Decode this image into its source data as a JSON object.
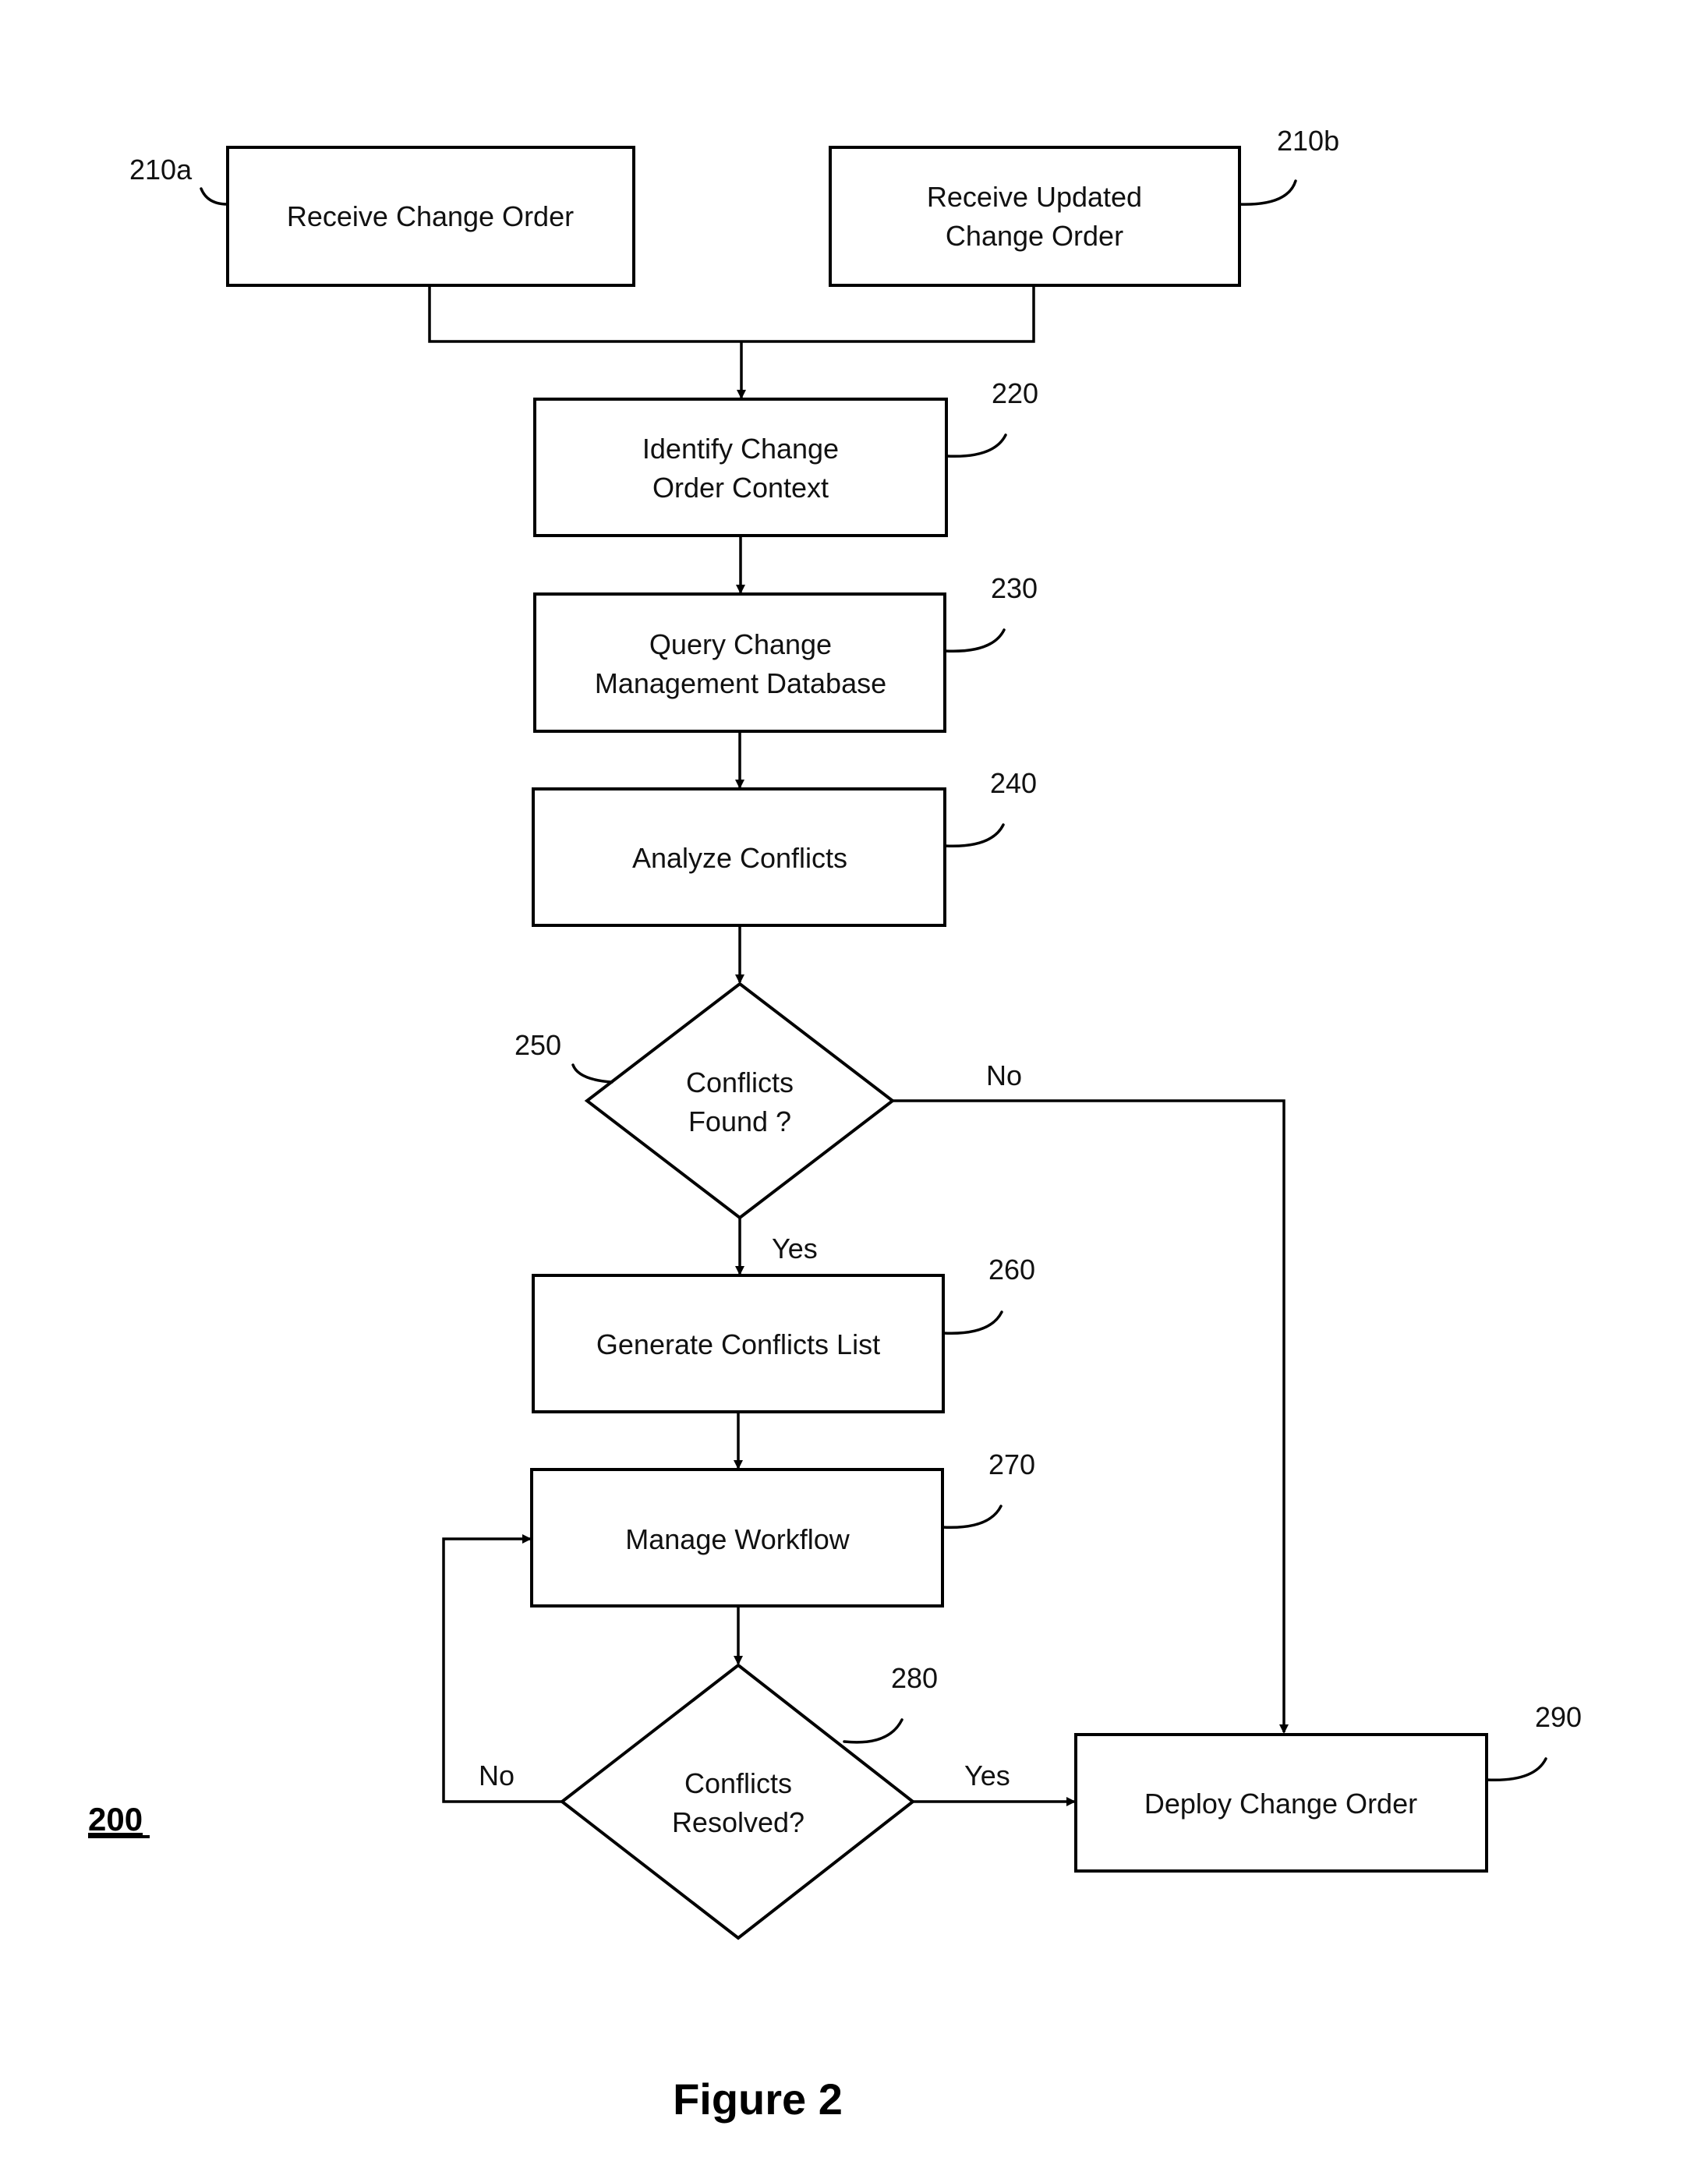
{
  "figure": {
    "label": "Figure 2",
    "reference_number": "200"
  },
  "nodes": [
    {
      "id": "210a",
      "ref": "210a",
      "type": "process",
      "lines": [
        "Receive Change Order"
      ]
    },
    {
      "id": "210b",
      "ref": "210b",
      "type": "process",
      "lines": [
        "Receive Updated",
        "Change Order"
      ]
    },
    {
      "id": "220",
      "ref": "220",
      "type": "process",
      "lines": [
        "Identify Change",
        "Order Context"
      ]
    },
    {
      "id": "230",
      "ref": "230",
      "type": "process",
      "lines": [
        "Query Change",
        "Management Database"
      ]
    },
    {
      "id": "240",
      "ref": "240",
      "type": "process",
      "lines": [
        "Analyze Conflicts"
      ]
    },
    {
      "id": "250",
      "ref": "250",
      "type": "decision",
      "lines": [
        "Conflicts",
        "Found ?"
      ]
    },
    {
      "id": "260",
      "ref": "260",
      "type": "process",
      "lines": [
        "Generate Conflicts List"
      ]
    },
    {
      "id": "270",
      "ref": "270",
      "type": "process",
      "lines": [
        "Manage Workflow"
      ]
    },
    {
      "id": "280",
      "ref": "280",
      "type": "decision",
      "lines": [
        "Conflicts",
        "Resolved?"
      ]
    },
    {
      "id": "290",
      "ref": "290",
      "type": "process",
      "lines": [
        "Deploy Change Order"
      ]
    }
  ],
  "edges": [
    {
      "from": "210a",
      "to": "220",
      "label": ""
    },
    {
      "from": "210b",
      "to": "220",
      "label": ""
    },
    {
      "from": "220",
      "to": "230",
      "label": ""
    },
    {
      "from": "230",
      "to": "240",
      "label": ""
    },
    {
      "from": "240",
      "to": "250",
      "label": ""
    },
    {
      "from": "250",
      "to": "260",
      "label": "Yes"
    },
    {
      "from": "250",
      "to": "290",
      "label": "No"
    },
    {
      "from": "260",
      "to": "270",
      "label": ""
    },
    {
      "from": "270",
      "to": "280",
      "label": ""
    },
    {
      "from": "280",
      "to": "290",
      "label": "Yes"
    },
    {
      "from": "280",
      "to": "270",
      "label": "No"
    }
  ]
}
